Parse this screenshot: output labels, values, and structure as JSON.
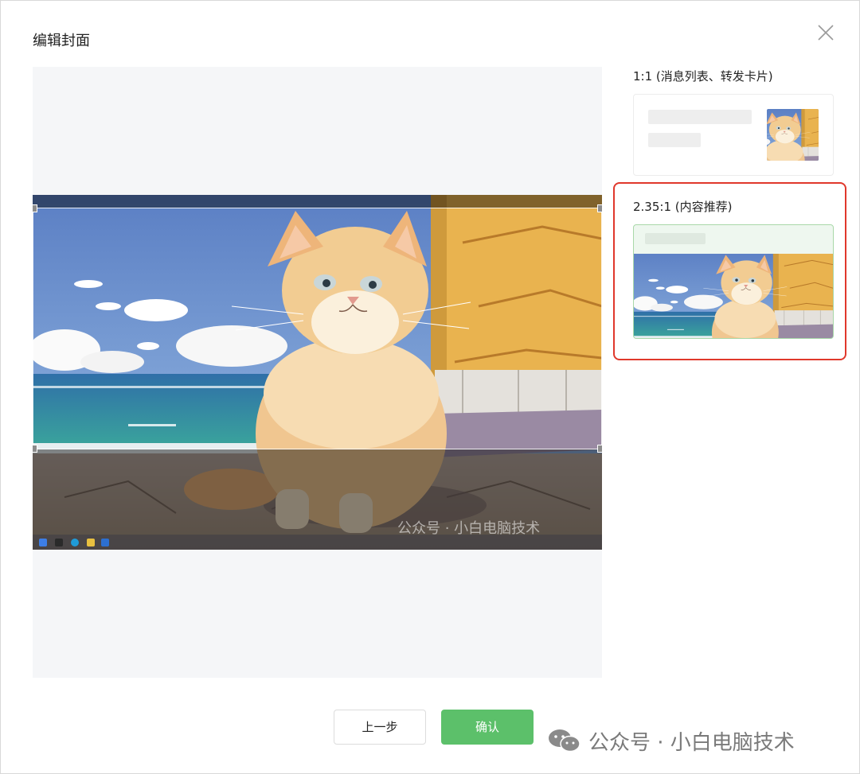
{
  "dialog": {
    "title": "编辑封面",
    "close_icon": "close-icon"
  },
  "editor": {
    "image_watermark": "公众号 · 小白电脑技术",
    "crop_ratio": "2.35:1"
  },
  "sidebar": {
    "preview1_label": "1:1 (消息列表、转发卡片)",
    "preview2_label": "2.35:1 (内容推荐)",
    "highlight_color": "#e0382c"
  },
  "footer": {
    "prev_label": "上一步",
    "confirm_label": "确认",
    "confirm_color": "#5cc06a"
  },
  "watermark": {
    "text": "公众号 · 小白电脑技术",
    "icon": "wechat-icon"
  }
}
